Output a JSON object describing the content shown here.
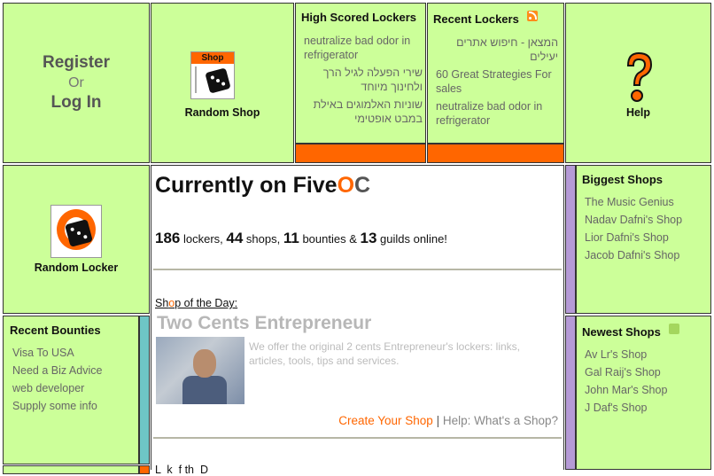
{
  "auth": {
    "register": "Register",
    "or": "Or",
    "login": "Log In"
  },
  "random_shop": {
    "badge": "Shop",
    "label": "Random Shop"
  },
  "high_scored": {
    "title": "High Scored Lockers",
    "items": [
      "neutralize bad odor in refrigerator",
      "שירי הפעלה לגיל הרך ולחינוך מיוחד",
      "שוניות האלמוגים באילת במבט אופטימי"
    ]
  },
  "recent_lockers": {
    "title": "Recent Lockers",
    "items": [
      "המצאן - חיפוש אתרים יעילים",
      "60 Great Strategies For sales",
      "neutralize bad odor in refrigerator"
    ]
  },
  "help": {
    "label": "Help"
  },
  "random_locker": {
    "label": "Random Locker"
  },
  "currently": {
    "title_prefix": "Currently on Five",
    "title_o": "O",
    "title_c": "C",
    "lockers_num": "186",
    "lockers_word": " lockers, ",
    "shops_num": "44",
    "shops_word": " shops, ",
    "bounties_num": "11",
    "bounties_word": " bounties & ",
    "guilds_num": "13",
    "guilds_word": " guilds online!"
  },
  "shop_of_day": {
    "label_a": "Sh",
    "label_o": "o",
    "label_b": "p of the Day:",
    "name": "Two Cents Entrepreneur",
    "desc": "We offer the original 2 cents Entrepreneur's lockers: links, articles, tools, tips and services.",
    "create": "Create Your Shop",
    "sep": " | ",
    "help": "Help: What's a Shop?"
  },
  "biggest_shops": {
    "title": "Biggest Shops",
    "items": [
      "The Music Genius",
      "Nadav Dafni's Shop",
      "Lior Dafni's Shop",
      "Jacob Dafni's Shop"
    ]
  },
  "recent_bounties": {
    "title": "Recent Bounties",
    "items": [
      "Visa To USA",
      "Need a Biz Advice",
      "web developer",
      "Supply some info"
    ]
  },
  "newest_shops": {
    "title": "Newest Shops",
    "items": [
      "Av Lr's Shop",
      "Gal Raij's Shop",
      "John Mar's Shop",
      "J Daf's Shop"
    ]
  },
  "footer_partial": {
    "label": "L  k  f th  D"
  }
}
